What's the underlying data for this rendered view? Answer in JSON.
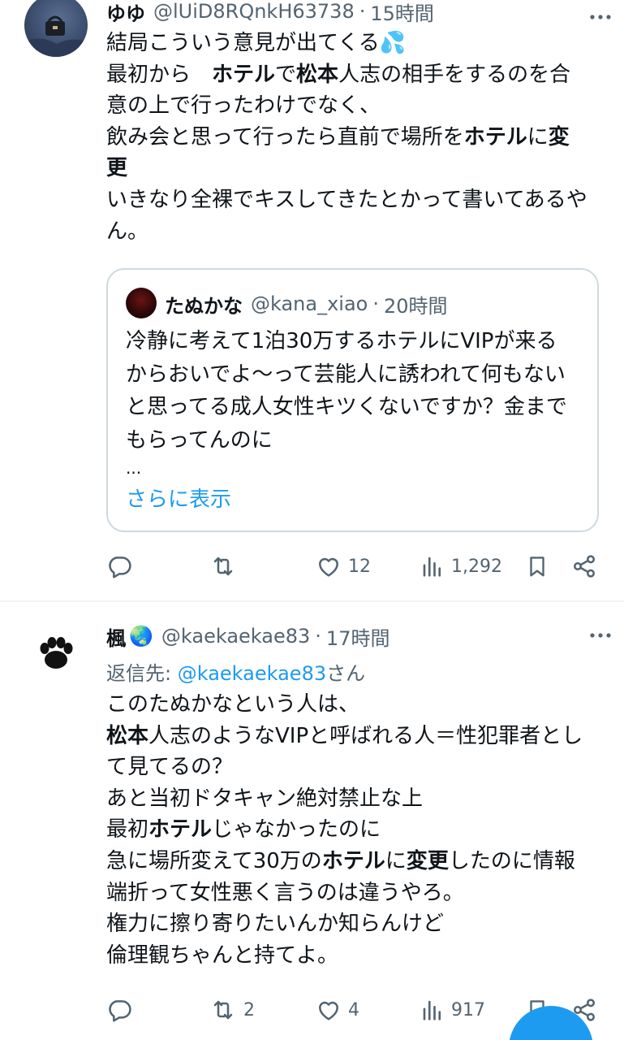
{
  "tweet1": {
    "author_name": "ゆゆ",
    "handle": "@lUiD8RQnkH63738",
    "time": "15時間",
    "lines": [
      [
        {
          "t": "結局こういう意見が出てくる"
        },
        {
          "t": "💦"
        }
      ],
      [
        {
          "t": "最初から　"
        },
        {
          "t": "ホテル",
          "b": true
        },
        {
          "t": "で"
        },
        {
          "t": "松本",
          "b": true
        },
        {
          "t": "人志の相手をするのを合"
        }
      ],
      [
        {
          "t": "意の上で行ったわけでなく、"
        }
      ],
      [
        {
          "t": "飲み会と思って行ったら直前で場所を"
        },
        {
          "t": "ホテル",
          "b": true
        },
        {
          "t": "に"
        },
        {
          "t": "変",
          "b": true
        }
      ],
      [
        {
          "t": "更",
          "b": true
        }
      ],
      [
        {
          "t": "いきなり全裸でキスしてきたとかって書いてあるや"
        }
      ],
      [
        {
          "t": "ん。"
        }
      ]
    ],
    "quote": {
      "author_name": "たぬかな",
      "handle": "@kana_xiao",
      "time": "20時間",
      "lines": [
        "冷静に考えて1泊30万するホテルにVIPが来る",
        "からおいでよ〜って芸能人に誘われて何もない",
        "と思ってる成人女性キツくないですか？金まで",
        "もらってんのに"
      ],
      "ellipsis": "...",
      "show_more": "さらに表示"
    },
    "actions": {
      "reply": "",
      "retweet": "",
      "like": "12",
      "views": "1,292"
    }
  },
  "tweet2": {
    "author_name": "楓",
    "author_emoji": "🌏",
    "handle": "@kaekaekae83",
    "time": "17時間",
    "reply_prefix": "返信先: ",
    "reply_handle": "@kaekaekae83",
    "reply_suffix": "さん",
    "lines": [
      [
        {
          "t": "このたぬかなという人は、"
        }
      ],
      [
        {
          "t": "松本",
          "b": true
        },
        {
          "t": "人志のようなVIPと呼ばれる人＝性犯罪者とし"
        }
      ],
      [
        {
          "t": "て見てるの？"
        }
      ],
      [
        {
          "t": "あと当初ドタキャン絶対禁止な上"
        }
      ],
      [
        {
          "t": "最初"
        },
        {
          "t": "ホテル",
          "b": true
        },
        {
          "t": "じゃなかったのに"
        }
      ],
      [
        {
          "t": "急に場所変えて30万の"
        },
        {
          "t": "ホテル",
          "b": true
        },
        {
          "t": "に"
        },
        {
          "t": "変更",
          "b": true
        },
        {
          "t": "したのに情報"
        }
      ],
      [
        {
          "t": "端折って女性悪く言うのは違うやろ。"
        }
      ],
      [
        {
          "t": "権力に擦り寄りたいんか知らんけど"
        }
      ],
      [
        {
          "t": "倫理観ちゃんと持てよ。"
        }
      ]
    ],
    "actions": {
      "reply": "",
      "retweet": "2",
      "like": "4",
      "views": "917"
    }
  },
  "dot": "·",
  "colors": {
    "accent": "#1d9bf0",
    "secondary_text": "#536471",
    "border": "#cfd9de"
  }
}
